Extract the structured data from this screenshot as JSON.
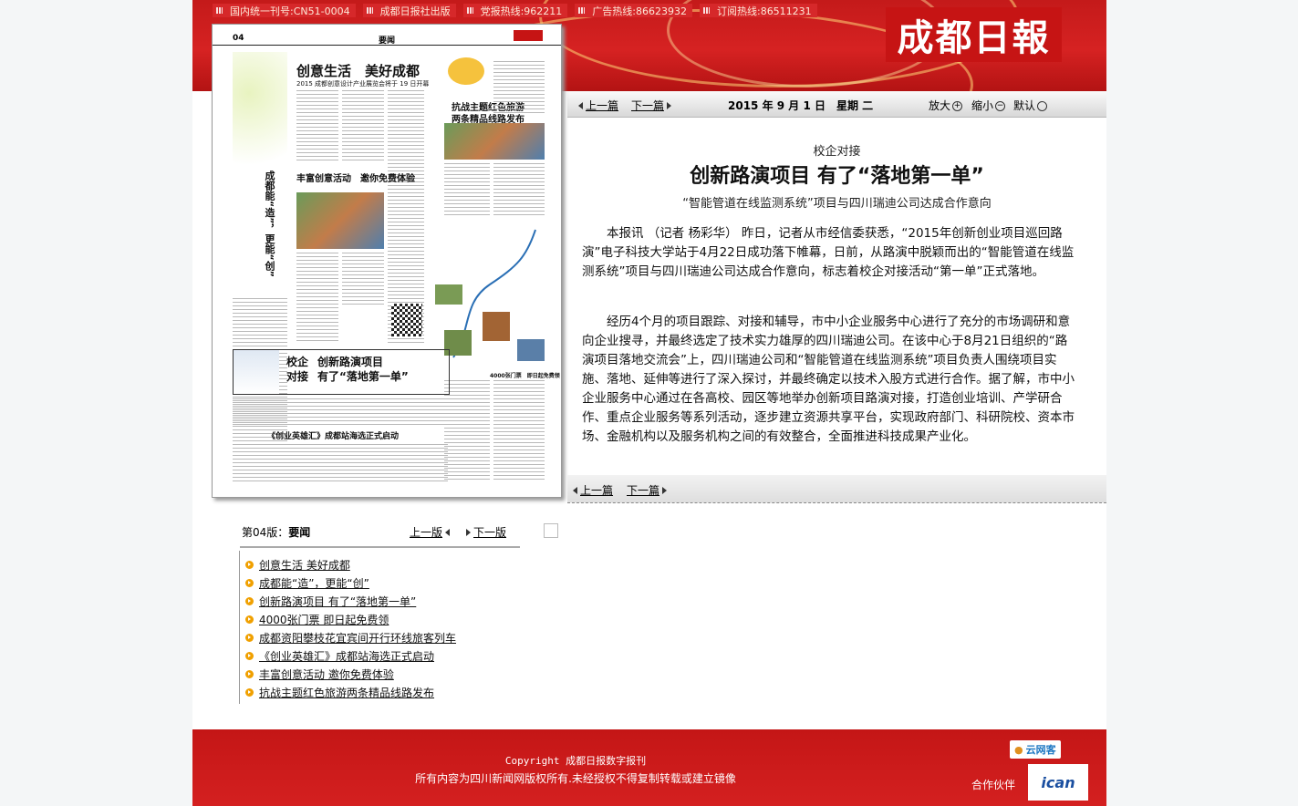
{
  "header": {
    "topbar": [
      "国内统一刊号:CN51-0004",
      "成都日报社出版",
      "党报热线:962211",
      "广告热线:86623932",
      "订阅热线:86511231"
    ],
    "logo_text": "成都日報"
  },
  "nav": {
    "prev_article": "上一篇",
    "next_article": "下一篇",
    "date": "2015 年 9 月 1 日　星期 二",
    "zoom_in": "放大",
    "zoom_out": "缩小",
    "default": "默认"
  },
  "article": {
    "kicker": "校企对接",
    "title": "创新路演项目 有了“落地第一单”",
    "subtitle": "“智能管道在线监测系统”项目与四川瑞迪公司达成合作意向",
    "paragraphs": [
      "本报讯 （记者 杨彩华） 昨日，记者从市经信委获悉，“2015年创新创业项目巡回路演”电子科技大学站于4月22日成功落下帷幕，日前，从路演中脱颖而出的“智能管道在线监测系统”项目与四川瑞迪公司达成合作意向，标志着校企对接活动“第一单”正式落地。",
      "经历4个月的项目跟踪、对接和辅导，市中小企业服务中心进行了充分的市场调研和意向企业搜寻，并最终选定了技术实力雄厚的四川瑞迪公司。在该中心于8月21日组织的“路演项目落地交流会”上，四川瑞迪公司和“智能管道在线监测系统”项目负责人围绕项目实施、落地、延伸等进行了深入探讨，并最终确定以技术入股方式进行合作。据了解，市中小企业服务中心通过在各高校、园区等地举办创新项目路演对接，打造创业培训、产学研合作、重点企业服务等系列活动，逐步建立资源共享平台，实现政府部门、科研院校、资本市场、金融机构以及服务机构之间的有效整合，全面推进科技成果产业化。"
    ]
  },
  "page_thumb": {
    "page_no": "04",
    "section": "要闻",
    "headlines": [
      "创意生活　美好成都",
      "2015 成都创意设计产业展览会将于 19 日开幕",
      "丰富创意活动　邀你免费体验",
      "抗战主题红色旅游",
      "两条精品线路发布",
      "成都能“造”，更能“创”",
      "校企",
      "对接",
      "创新路演项目",
      "有了“落地第一单”",
      "《创业英雄汇》成都站海选正式启动",
      "4000张门票　即日起免费领"
    ]
  },
  "page_nav": {
    "page_label": "第04版：",
    "page_name": "要闻",
    "prev_page": "上一版",
    "next_page": "下一版"
  },
  "page_articles": [
    "创意生活 美好成都",
    "成都能“造”，更能“创”",
    "创新路演项目 有了“落地第一单”",
    "4000张门票 即日起免费领",
    "成都资阳攀枝花宜宾间开行环线旅客列车",
    "《创业英雄汇》成都站海选正式启动",
    "丰富创意活动 邀你免费体验",
    "抗战主题红色旅游两条精品线路发布"
  ],
  "footer": {
    "copyright": "Copyright 成都日报数字报刊",
    "rights": "所有内容为四川新闻网版权所有.未经授权不得复制转载或建立镜像",
    "partner_label": "合作伙伴",
    "yunwangke": "云网客",
    "ican": "ican"
  },
  "colors": {
    "banner_red": "#c41a1a",
    "logo_red": "#c61414",
    "bullet_orange": "#f0a000"
  }
}
